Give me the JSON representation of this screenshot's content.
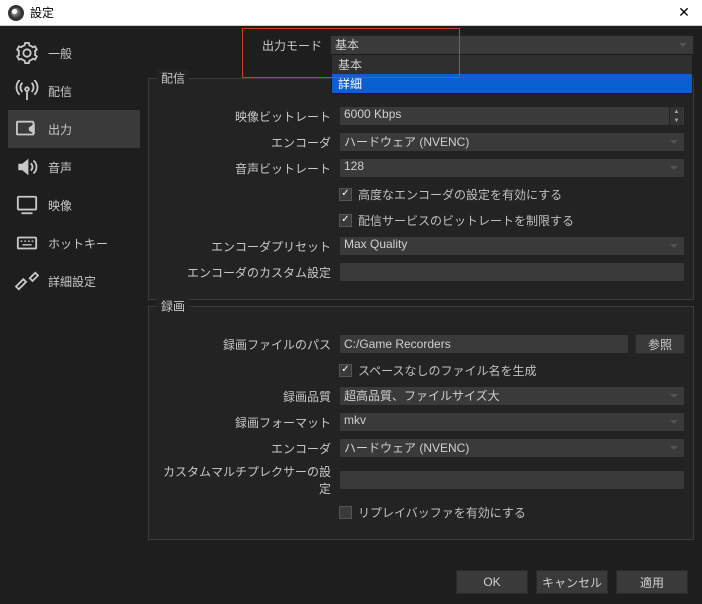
{
  "titlebar": {
    "title": "設定"
  },
  "sidebar": {
    "items": [
      {
        "label": "一般"
      },
      {
        "label": "配信"
      },
      {
        "label": "出力"
      },
      {
        "label": "音声"
      },
      {
        "label": "映像"
      },
      {
        "label": "ホットキー"
      },
      {
        "label": "詳細設定"
      }
    ]
  },
  "output_mode": {
    "label": "出力モード",
    "value": "基本",
    "options": [
      "基本",
      "詳細"
    ]
  },
  "streaming": {
    "legend": "配信",
    "video_bitrate": {
      "label": "映像ビットレート",
      "value": "6000 Kbps"
    },
    "encoder": {
      "label": "エンコーダ",
      "value": "ハードウェア (NVENC)"
    },
    "audio_bitrate": {
      "label": "音声ビットレート",
      "value": "128"
    },
    "adv_encoder_checkbox": {
      "label": "高度なエンコーダの設定を有効にする",
      "checked": true
    },
    "enforce_service_checkbox": {
      "label": "配信サービスのビットレートを制限する",
      "checked": true
    },
    "encoder_preset": {
      "label": "エンコーダプリセット",
      "value": "Max Quality"
    },
    "custom_encoder": {
      "label": "エンコーダのカスタム設定",
      "value": ""
    }
  },
  "recording": {
    "legend": "録画",
    "path": {
      "label": "録画ファイルのパス",
      "value": "C:/Game Recorders",
      "browse": "参照"
    },
    "no_space_checkbox": {
      "label": "スペースなしのファイル名を生成",
      "checked": true
    },
    "quality": {
      "label": "録画品質",
      "value": "超高品質、ファイルサイズ大"
    },
    "format": {
      "label": "録画フォーマット",
      "value": "mkv"
    },
    "encoder": {
      "label": "エンコーダ",
      "value": "ハードウェア (NVENC)"
    },
    "muxer": {
      "label": "カスタムマルチプレクサーの設定",
      "value": ""
    },
    "replay_buffer_checkbox": {
      "label": "リプレイバッファを有効にする",
      "checked": false
    }
  },
  "footer": {
    "ok": "OK",
    "cancel": "キャンセル",
    "apply": "適用"
  }
}
